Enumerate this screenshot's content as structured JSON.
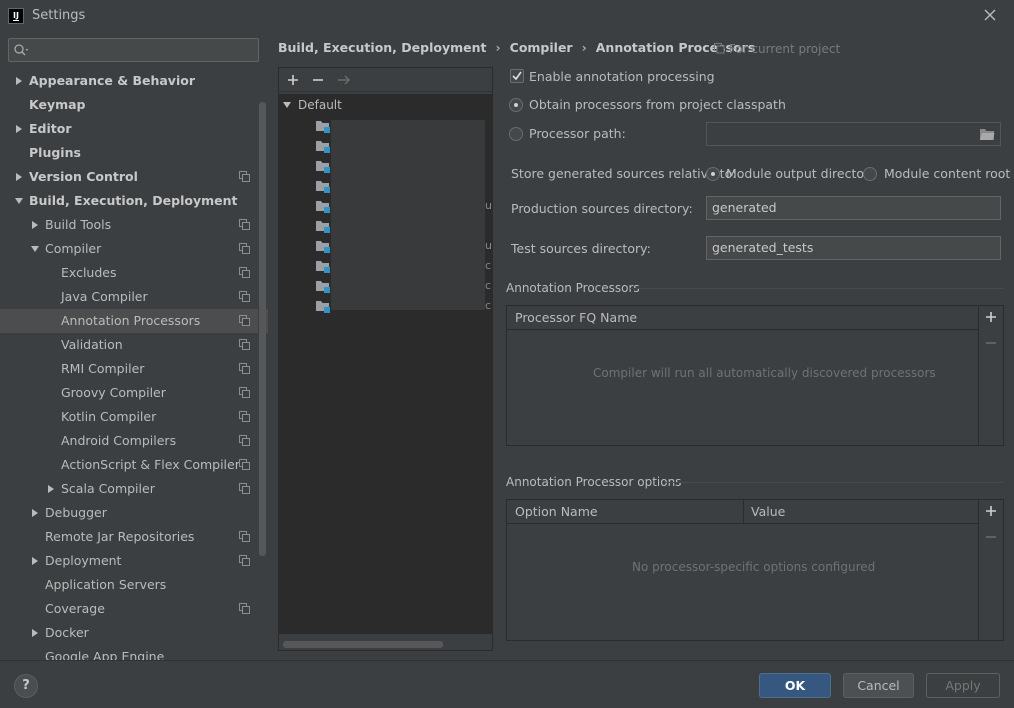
{
  "window": {
    "title": "Settings",
    "logo_text": "IJ"
  },
  "search": {
    "placeholder": "",
    "value": ""
  },
  "tree": [
    {
      "label": "Appearance & Behavior",
      "level": 0,
      "expandable": true,
      "expanded": false,
      "bold": true,
      "project_icon": false
    },
    {
      "label": "Keymap",
      "level": 0,
      "expandable": false,
      "bold": true,
      "project_icon": false
    },
    {
      "label": "Editor",
      "level": 0,
      "expandable": true,
      "expanded": false,
      "bold": true,
      "project_icon": false
    },
    {
      "label": "Plugins",
      "level": 0,
      "expandable": false,
      "bold": true,
      "project_icon": false
    },
    {
      "label": "Version Control",
      "level": 0,
      "expandable": true,
      "expanded": false,
      "bold": true,
      "project_icon": true
    },
    {
      "label": "Build, Execution, Deployment",
      "level": 0,
      "expandable": true,
      "expanded": true,
      "bold": true,
      "project_icon": false
    },
    {
      "label": "Build Tools",
      "level": 1,
      "expandable": true,
      "expanded": false,
      "bold": false,
      "project_icon": true
    },
    {
      "label": "Compiler",
      "level": 1,
      "expandable": true,
      "expanded": true,
      "bold": false,
      "project_icon": true
    },
    {
      "label": "Excludes",
      "level": 2,
      "expandable": false,
      "bold": false,
      "project_icon": true
    },
    {
      "label": "Java Compiler",
      "level": 2,
      "expandable": false,
      "bold": false,
      "project_icon": true
    },
    {
      "label": "Annotation Processors",
      "level": 2,
      "expandable": false,
      "bold": false,
      "project_icon": true,
      "selected": true
    },
    {
      "label": "Validation",
      "level": 2,
      "expandable": false,
      "bold": false,
      "project_icon": true
    },
    {
      "label": "RMI Compiler",
      "level": 2,
      "expandable": false,
      "bold": false,
      "project_icon": true
    },
    {
      "label": "Groovy Compiler",
      "level": 2,
      "expandable": false,
      "bold": false,
      "project_icon": true
    },
    {
      "label": "Kotlin Compiler",
      "level": 2,
      "expandable": false,
      "bold": false,
      "project_icon": true
    },
    {
      "label": "Android Compilers",
      "level": 2,
      "expandable": false,
      "bold": false,
      "project_icon": true
    },
    {
      "label": "ActionScript & Flex Compiler",
      "level": 2,
      "expandable": false,
      "bold": false,
      "project_icon": true
    },
    {
      "label": "Scala Compiler",
      "level": 2,
      "expandable": true,
      "expanded": false,
      "bold": false,
      "project_icon": true
    },
    {
      "label": "Debugger",
      "level": 1,
      "expandable": true,
      "expanded": false,
      "bold": false,
      "project_icon": false
    },
    {
      "label": "Remote Jar Repositories",
      "level": 1,
      "expandable": false,
      "bold": false,
      "project_icon": true
    },
    {
      "label": "Deployment",
      "level": 1,
      "expandable": true,
      "expanded": false,
      "bold": false,
      "project_icon": true
    },
    {
      "label": "Application Servers",
      "level": 1,
      "expandable": false,
      "bold": false,
      "project_icon": false
    },
    {
      "label": "Coverage",
      "level": 1,
      "expandable": false,
      "bold": false,
      "project_icon": true
    },
    {
      "label": "Docker",
      "level": 1,
      "expandable": true,
      "expanded": false,
      "bold": false,
      "project_icon": false
    },
    {
      "label": "Google App Engine",
      "level": 1,
      "expandable": false,
      "bold": false,
      "project_icon": false
    }
  ],
  "breadcrumb": [
    "Build, Execution, Deployment",
    "Compiler",
    "Annotation Processors"
  ],
  "current_project_label": "For current project",
  "profiles": {
    "default_label": "Default",
    "module_count": 10,
    "partial_letters": [
      "",
      "",
      "",
      "",
      "u",
      "",
      "u",
      "c",
      "c",
      "c"
    ]
  },
  "settings": {
    "enable_processing": {
      "label": "Enable annotation processing",
      "checked": true
    },
    "obtain_from_classpath": {
      "label": "Obtain processors from project classpath",
      "selected": true
    },
    "processor_path": {
      "label": "Processor path:",
      "selected": false,
      "value": ""
    },
    "store_relative": {
      "label": "Store generated sources relative to:"
    },
    "module_output": {
      "label": "Module output directory",
      "selected": true
    },
    "module_content": {
      "label": "Module content root",
      "selected": false
    },
    "production_dir": {
      "label": "Production sources directory:",
      "value": "generated"
    },
    "test_dir": {
      "label": "Test sources directory:",
      "value": "generated_tests"
    }
  },
  "processors_section": {
    "title": "Annotation Processors",
    "column": "Processor FQ Name",
    "empty_text": "Compiler will run all automatically discovered processors"
  },
  "options_section": {
    "title": "Annotation Processor options",
    "columns": [
      "Option Name",
      "Value"
    ],
    "empty_text": "No processor-specific options configured"
  },
  "buttons": {
    "help": "?",
    "ok": "OK",
    "cancel": "Cancel",
    "apply": "Apply"
  },
  "colors": {
    "background": "#3c3f41",
    "ok_button": "#365880",
    "selected_row": "#4b4d4e",
    "module_badge": "#3592c4"
  }
}
